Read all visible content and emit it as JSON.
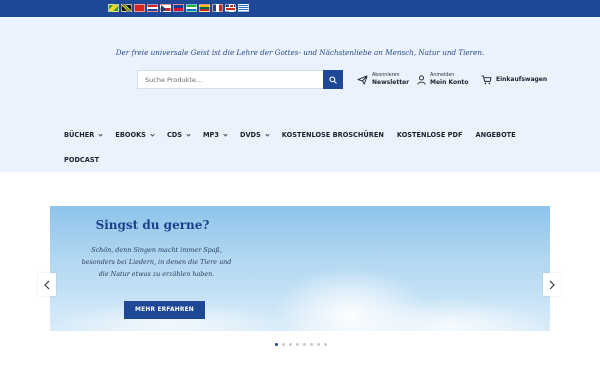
{
  "colors": {
    "brand_blue": "#1e4796",
    "header_bg": "#eaf2fd",
    "title_blue": "#1e3f8a"
  },
  "language_flags": [
    {
      "icon": "flag-brazil-icon"
    },
    {
      "icon": "flag-jamaica-icon"
    },
    {
      "icon": "flag-china-icon"
    },
    {
      "icon": "flag-croatia-icon"
    },
    {
      "icon": "flag-czech-icon"
    },
    {
      "icon": "flag-haiti-icon"
    },
    {
      "icon": "flag-sierra-leone-icon"
    },
    {
      "icon": "flag-lithuania-icon"
    },
    {
      "icon": "flag-france-icon"
    },
    {
      "icon": "flag-uk-icon"
    },
    {
      "icon": "flag-greece-icon"
    }
  ],
  "header": {
    "tagline": "Der freie universale Geist ist die Lehre der Gottes- und Nächstenliebe an Mensch, Natur und Tieren.",
    "search": {
      "placeholder": "Suche Produkte…",
      "icon": "search-icon"
    },
    "newsletter": {
      "small": "Abonnieren",
      "label": "Newsletter",
      "icon": "paper-plane-icon"
    },
    "account": {
      "small": "Anmelden",
      "label": "Mein Konto",
      "icon": "user-icon"
    },
    "cart": {
      "label": "Einkaufswagen",
      "icon": "cart-icon"
    }
  },
  "nav": {
    "items": [
      {
        "label": "BÜCHER",
        "dropdown": true
      },
      {
        "label": "EBOOKS",
        "dropdown": true
      },
      {
        "label": "CDS",
        "dropdown": true
      },
      {
        "label": "MP3",
        "dropdown": true
      },
      {
        "label": "DVDS",
        "dropdown": true
      },
      {
        "label": "KOSTENLOSE BROSCHÜREN",
        "dropdown": false
      },
      {
        "label": "KOSTENLOSE PDF",
        "dropdown": false
      },
      {
        "label": "ANGEBOTE",
        "dropdown": false
      },
      {
        "label": "PODCAST",
        "dropdown": false
      }
    ]
  },
  "slider": {
    "title": "Singst du gerne?",
    "text_lines": [
      "Schön, denn Singen macht immer Spaß,",
      "besonders bei Liedern, in denen die Tiere und",
      "die Natur etwas zu erzählen haben."
    ],
    "button": "MEHR ERFAHREN",
    "prev_icon": "chevron-left-icon",
    "next_icon": "chevron-right-icon",
    "slide_count": 8,
    "active_slide": 1
  }
}
